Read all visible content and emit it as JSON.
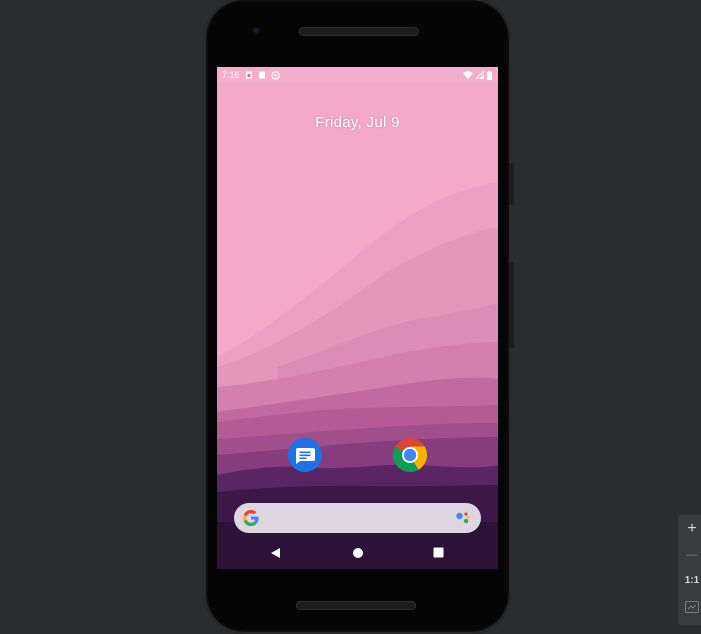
{
  "status_bar": {
    "time": "7:16",
    "left_icons": [
      "sim-icon",
      "sd-card-icon",
      "sync-icon"
    ],
    "right_icons": [
      "wifi-icon",
      "signal-icon",
      "battery-icon"
    ]
  },
  "home": {
    "date": "Friday, Jul 9",
    "apps": [
      {
        "name": "messages-app-icon",
        "color": "#1a73e8"
      },
      {
        "name": "chrome-app-icon",
        "color": "#4285f4"
      }
    ],
    "search": {
      "logo": "google-g-icon",
      "assistant": "google-assistant-icon"
    }
  },
  "nav": [
    "back-button",
    "home-button",
    "recents-button"
  ],
  "zoom_controls": {
    "plus": "+",
    "minus": "—",
    "ratio": "1:1"
  },
  "colors": {
    "background": "#2b2c2e",
    "wallpaper_sky": "#f4a9c9",
    "wallpaper_dark": "#2b1236",
    "search_bar": "#ddd5e0"
  }
}
